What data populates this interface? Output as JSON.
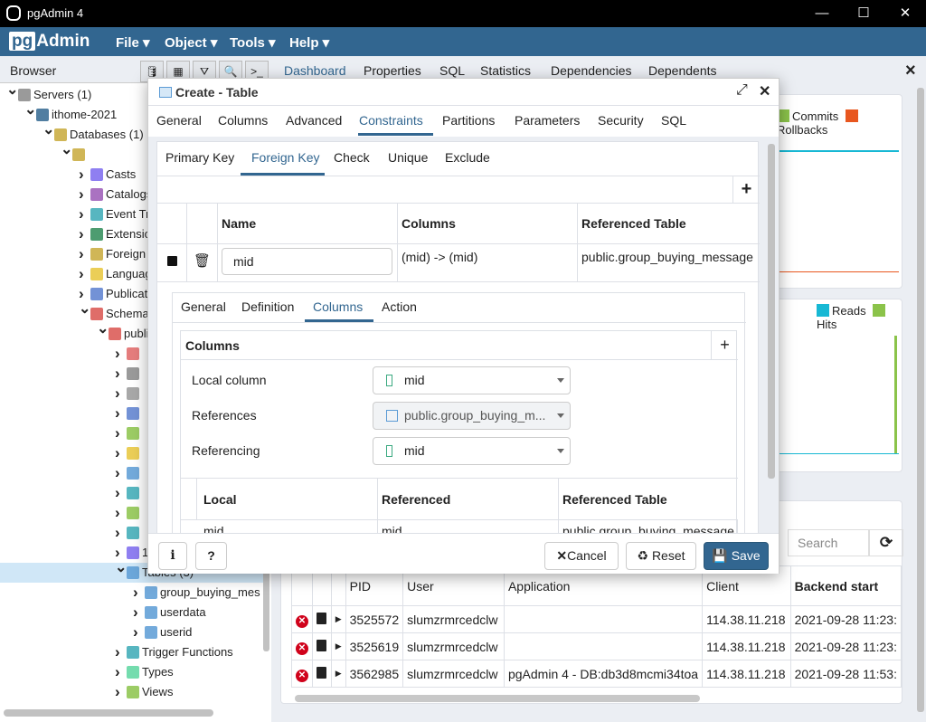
{
  "window": {
    "title": "pgAdmin 4",
    "minimize": "—",
    "maximize": "☐",
    "close": "✕"
  },
  "menubar": {
    "logo": "pgAdmin",
    "logo_prefix": "pg",
    "logo_suffix": "Admin",
    "items": [
      "File ▾",
      "Object ▾",
      "Tools ▾",
      "Help ▾"
    ]
  },
  "browser": {
    "title": "Browser",
    "toolbar": [
      "database-icon",
      "table-icon",
      "filter-icon",
      "search-icon",
      "terminal-icon"
    ]
  },
  "main_tabs": {
    "items": [
      "Dashboard",
      "Properties",
      "SQL",
      "Statistics",
      "Dependencies",
      "Dependents"
    ],
    "active": "Dashboard",
    "close": "×"
  },
  "tree": [
    {
      "label": "Servers (1)",
      "icon": "servers-icon",
      "color": "#888"
    },
    {
      "label": "ithome-2021",
      "icon": "postgres-elephant-icon",
      "color": "#336791"
    },
    {
      "label": "Databases (1)",
      "icon": "databases-icon",
      "color": "#c8a93a"
    },
    {
      "label": "",
      "icon": "database-icon",
      "color": "#c8a93a"
    },
    {
      "label": "Casts",
      "icon": "casts-icon",
      "color": "#7b68ee"
    },
    {
      "label": "Catalogs",
      "icon": "catalogs-icon",
      "color": "#9b59b6"
    },
    {
      "label": "Event Triggers",
      "icon": "event-triggers-icon",
      "color": "#3aa9b5"
    },
    {
      "label": "Extensions",
      "icon": "extensions-icon",
      "color": "#2e8b57"
    },
    {
      "label": "Foreign Data Wrappers",
      "icon": "foreign-data-wrappers-icon",
      "color": "#c8a93a"
    },
    {
      "label": "Languages",
      "icon": "languages-icon",
      "color": "#e8c53a"
    },
    {
      "label": "Publications",
      "icon": "publications-icon",
      "color": "#5b7fcf"
    },
    {
      "label": "Schemas",
      "icon": "schemas-icon",
      "color": "#d9534f"
    },
    {
      "label": "public",
      "icon": "schema-icon",
      "color": "#d9534f"
    },
    {
      "label": "",
      "icon": "collations-icon",
      "color": "#e06666"
    },
    {
      "label": "",
      "icon": "domains-icon",
      "color": "#888"
    },
    {
      "label": "",
      "icon": "fts-configurations-icon",
      "color": "#999"
    },
    {
      "label": "",
      "icon": "fts-dictionaries-icon",
      "color": "#5b7fcf"
    },
    {
      "label": "",
      "icon": "fts-parsers-icon",
      "color": "#8bc34a"
    },
    {
      "label": "",
      "icon": "fts-templates-icon",
      "color": "#e8c53a"
    },
    {
      "label": "",
      "icon": "foreign-tables-icon",
      "color": "#5b9bd5"
    },
    {
      "label": "",
      "icon": "functions-icon",
      "color": "#3aa9b5"
    },
    {
      "label": "",
      "icon": "materialized-views-icon",
      "color": "#8bc34a"
    },
    {
      "label": "",
      "icon": "procedures-icon",
      "color": "#3aa9b5"
    },
    {
      "label": "1..3",
      "icon": "sequences-icon",
      "color": "#7b68ee"
    },
    {
      "label": "Tables (3)",
      "icon": "tables-icon",
      "color": "#5b9bd5"
    },
    {
      "label": "group_buying_mes",
      "icon": "table-icon",
      "color": "#5b9bd5"
    },
    {
      "label": "userdata",
      "icon": "table-icon",
      "color": "#5b9bd5"
    },
    {
      "label": "userid",
      "icon": "table-icon",
      "color": "#5b9bd5"
    },
    {
      "label": "Trigger Functions",
      "icon": "trigger-functions-icon",
      "color": "#3aa9b5"
    },
    {
      "label": "Types",
      "icon": "types-icon",
      "color": "#5cd6a0"
    },
    {
      "label": "Views",
      "icon": "views-icon",
      "color": "#8bc34a"
    }
  ],
  "dashboard": {
    "tx_legend": [
      {
        "label": "Commits",
        "color": "#8bc34a"
      },
      {
        "label": "Rollbacks",
        "color": "#e8571f"
      }
    ],
    "io_legend": [
      {
        "label": "Reads",
        "color": "#17b8d4"
      },
      {
        "label": "Hits",
        "color": "#8bc34a"
      }
    ],
    "sessions": {
      "search_placeholder": "Search",
      "columns": [
        "",
        "",
        "",
        "PID",
        "User",
        "Application",
        "Client",
        "Backend start"
      ],
      "rows": [
        [
          "3525572",
          "slumzrmrcedclw",
          "",
          "114.38.11.218",
          "2021-09-28 11:23:"
        ],
        [
          "3525619",
          "slumzrmrcedclw",
          "",
          "114.38.11.218",
          "2021-09-28 11:23:"
        ],
        [
          "3562985",
          "slumzrmrcedclw",
          "pgAdmin 4 - DB:db3d8mcmi34toa",
          "114.38.11.218",
          "2021-09-28 11:53:"
        ]
      ]
    }
  },
  "dialog": {
    "title": "Create - Table",
    "tabs": [
      "General",
      "Columns",
      "Advanced",
      "Constraints",
      "Partitions",
      "Parameters",
      "Security",
      "SQL"
    ],
    "active_tab": "Constraints",
    "subtabs": [
      "Primary Key",
      "Foreign Key",
      "Check",
      "Unique",
      "Exclude"
    ],
    "active_subtab": "Foreign Key",
    "add": "+",
    "fk_grid": {
      "headers": [
        "Name",
        "Columns",
        "Referenced Table"
      ],
      "row": {
        "name": "mid",
        "columns": "(mid) -> (mid)",
        "referenced_table": "public.group_buying_message"
      }
    },
    "fk_detail": {
      "tabs": [
        "General",
        "Definition",
        "Columns",
        "Action"
      ],
      "active_tab": "Columns",
      "section_title": "Columns",
      "fields": [
        {
          "label": "Local column",
          "value": "mid",
          "icon": "column-icon",
          "disabled": false
        },
        {
          "label": "References",
          "value": "public.group_buying_m...",
          "icon": "table-icon",
          "disabled": true
        },
        {
          "label": "Referencing",
          "value": "mid",
          "icon": "column-icon",
          "disabled": false
        }
      ],
      "grid_headers": [
        "Local",
        "Referenced",
        "Referenced Table"
      ],
      "grid_row": [
        "mid",
        "mid",
        "public.group_buying_message"
      ]
    },
    "footer": {
      "info": "i",
      "help": "?",
      "cancel": "Cancel",
      "reset": "Reset",
      "save": "Save"
    }
  }
}
